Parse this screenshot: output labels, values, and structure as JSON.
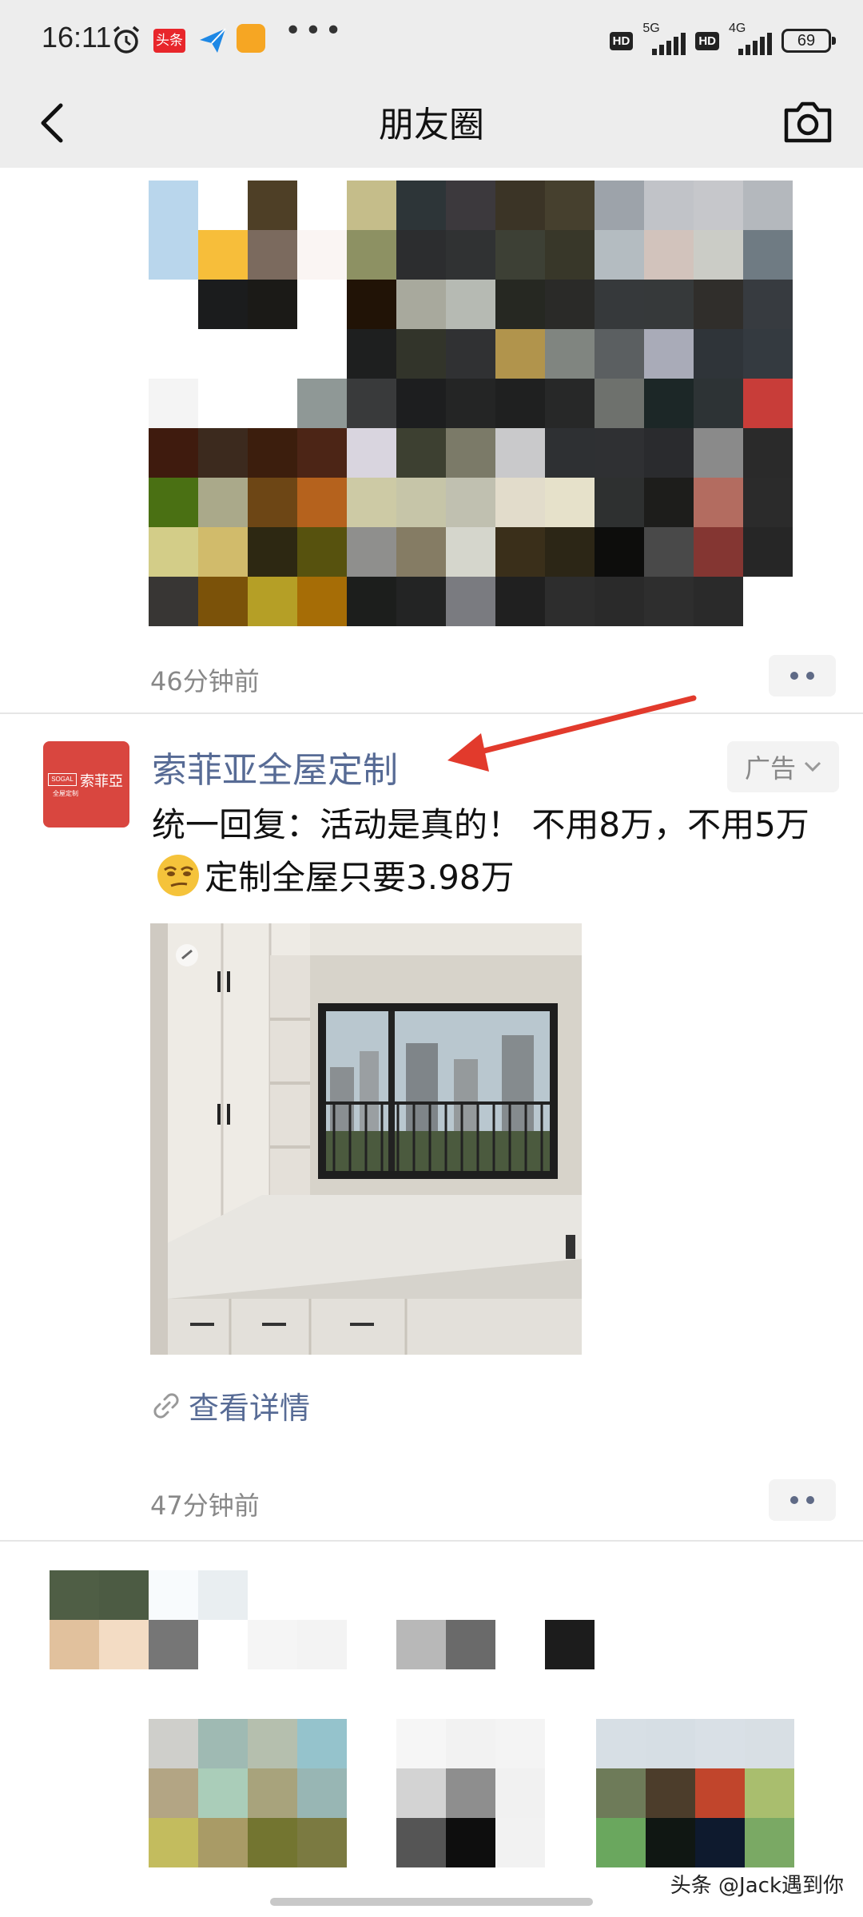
{
  "status_bar": {
    "time": "16:11",
    "toutiao_badge": "头条",
    "hd1": "HD",
    "net1": "5G",
    "hd2": "HD",
    "net2": "4G",
    "battery": "69"
  },
  "header": {
    "title": "朋友圈"
  },
  "feed": {
    "post1": {
      "time": "46分钟前"
    },
    "ad_post": {
      "name": "索菲亚全屋定制",
      "ad_label": "广告",
      "text_part1": "统一回复：活动是真的！ 不用8万，不用5万",
      "text_part2": "定制全屋只要3.98万",
      "avatar_logo_en": "SOGAL",
      "avatar_logo_cn": "索菲亞",
      "avatar_logo_sub": "全屋定制",
      "link_label": "查看详情",
      "time": "47分钟前"
    }
  },
  "watermark": "头条 @Jack遇到你",
  "colors": {
    "link_blue": "#576b95",
    "bar_bg": "#ededed",
    "avatar_red": "#d9463f",
    "arrow_red": "#e23a2c"
  }
}
